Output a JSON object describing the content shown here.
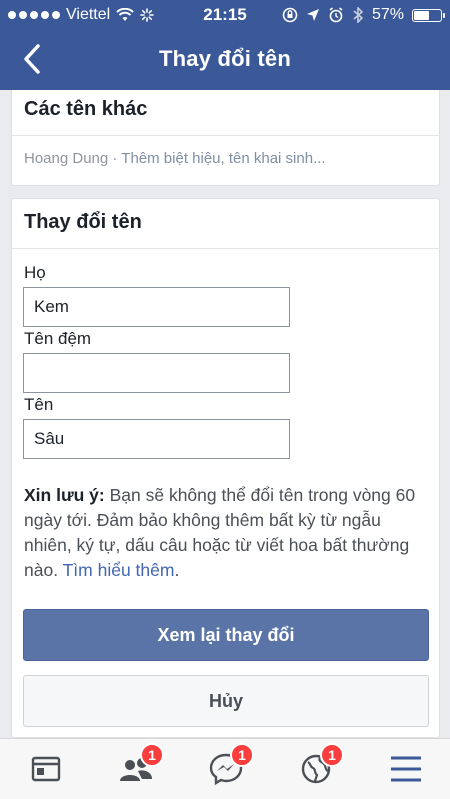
{
  "status_bar": {
    "carrier": "Viettel",
    "time": "21:15",
    "battery": "57%"
  },
  "header": {
    "title": "Thay đổi tên"
  },
  "other_names": {
    "heading": "Các tên khác",
    "current": "Hoang Dung",
    "separator": " · ",
    "add_link": "Thêm biệt hiệu, tên khai sinh..."
  },
  "change_name": {
    "heading": "Thay đổi tên",
    "fields": {
      "last_name_label": "Họ",
      "last_name_value": "Kem",
      "middle_name_label": "Tên đệm",
      "middle_name_value": "",
      "first_name_label": "Tên",
      "first_name_value": "Sâu"
    },
    "note_bold": "Xin lưu ý:",
    "note_text": " Bạn sẽ không thể đổi tên trong vòng 60 ngày tới. Đảm bảo không thêm bất kỳ từ ngẫu nhiên, ký tự, dấu câu hoặc từ viết hoa bất thường nào. ",
    "note_link": "Tìm hiểu thêm",
    "note_end": ".",
    "review_button": "Xem lại thay đổi",
    "cancel_button": "Hủy"
  },
  "tabbar": {
    "tabs": [
      {
        "icon": "news-feed-icon"
      },
      {
        "icon": "friend-requests-icon",
        "badge": "1"
      },
      {
        "icon": "messenger-icon",
        "badge": "1"
      },
      {
        "icon": "notifications-globe-icon",
        "badge": "1"
      },
      {
        "icon": "menu-icon"
      }
    ]
  },
  "colors": {
    "brand_blue": "#3b5998",
    "button_blue": "#5b74a8",
    "badge_red": "#fa3e3e",
    "link_blue": "#4267b2"
  }
}
